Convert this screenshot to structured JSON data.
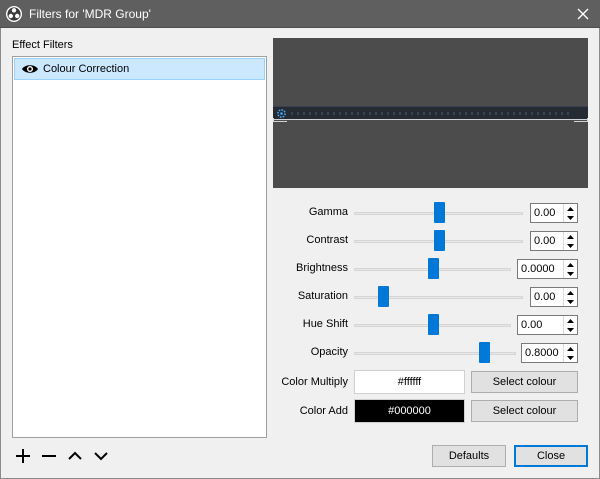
{
  "window": {
    "title": "Filters for 'MDR Group'",
    "close_icon": "close-icon",
    "app_icon": "obs-logo-icon"
  },
  "filters": {
    "label": "Effect Filters",
    "items": [
      {
        "name": "Colour Correction",
        "visible": true,
        "selected": true,
        "icon": "eye-icon"
      }
    ],
    "tools": [
      {
        "icon": "plus-icon",
        "name": "add-filter-button"
      },
      {
        "icon": "minus-icon",
        "name": "remove-filter-button"
      },
      {
        "icon": "chevron-up-icon",
        "name": "move-up-button"
      },
      {
        "icon": "chevron-down-icon",
        "name": "move-down-button"
      }
    ]
  },
  "properties": {
    "gamma": {
      "label": "Gamma",
      "value": "0.00",
      "level": 0.5
    },
    "contrast": {
      "label": "Contrast",
      "value": "0.00",
      "level": 0.5
    },
    "brightness": {
      "label": "Brightness",
      "value": "0.0000",
      "level": 0.5
    },
    "saturation": {
      "label": "Saturation",
      "value": "0.00",
      "level": 0.17
    },
    "hue_shift": {
      "label": "Hue Shift",
      "value": "0.00",
      "level": 0.5
    },
    "opacity": {
      "label": "Opacity",
      "value": "0.8000",
      "level": 0.8
    },
    "color_multiply": {
      "label": "Color Multiply",
      "value": "#ffffff",
      "swatch": "#ffffff",
      "text_color": "#000000",
      "button": "Select colour"
    },
    "color_add": {
      "label": "Color Add",
      "value": "#000000",
      "swatch": "#000000",
      "text_color": "#ffffff",
      "button": "Select colour"
    }
  },
  "footer": {
    "defaults_label": "Defaults",
    "close_label": "Close"
  },
  "colors": {
    "titlebar": "#5f5f5f",
    "selection": "#cce8ff",
    "accent": "#0078d7",
    "preview_bg": "#4c4c4c"
  }
}
